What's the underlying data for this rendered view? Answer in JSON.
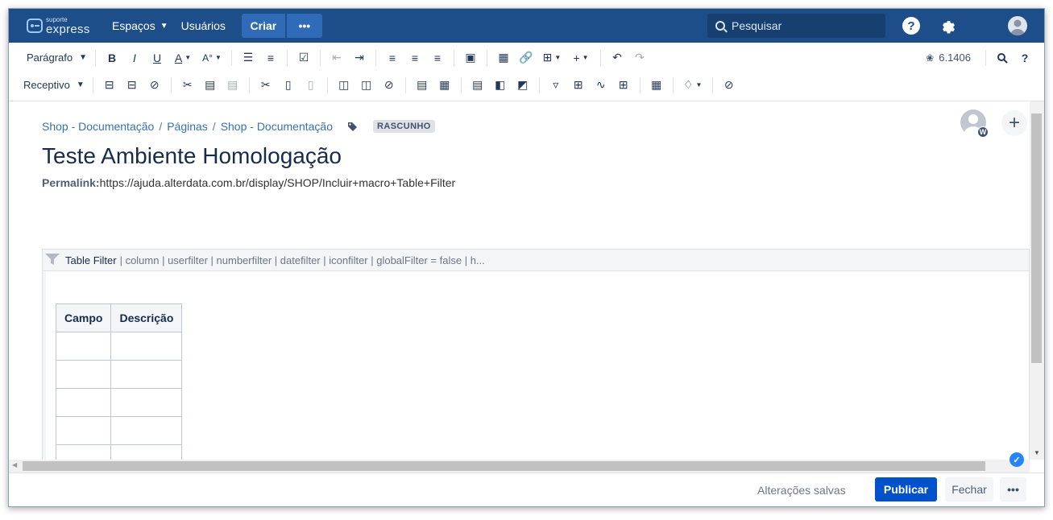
{
  "topnav": {
    "logo_small": "suporte",
    "logo_big": "express",
    "spaces_label": "Espaços",
    "users_label": "Usuários",
    "create_label": "Criar",
    "more_label": "•••",
    "search_placeholder": "Pesquisar",
    "help_label": "?"
  },
  "toolbar": {
    "paragraph_label": "Parágrafo",
    "bold": "B",
    "italic": "I",
    "underline": "U",
    "text_color": "A",
    "more_format": "A°",
    "version_label": "6.1406",
    "search_icon_label": "🔍",
    "help_label": "?",
    "receptivo_label": "Receptivo"
  },
  "page": {
    "breadcrumb": [
      "Shop - Documentação",
      "Páginas",
      "Shop - Documentação"
    ],
    "draft_badge": "RASCUNHO",
    "title": "Teste Ambiente Homologação",
    "permalink_label": "Permalink:",
    "permalink_url": "https://ajuda.alterdata.com.br/display/SHOP/Incluir+macro+Table+Filter",
    "editor_initial": "W"
  },
  "macro": {
    "name": "Table Filter",
    "params": "| column | userfilter | numberfilter | datefilter | iconfilter | globalFilter = false | h..."
  },
  "table": {
    "headers": [
      "Campo",
      "Descrição"
    ],
    "row_count": 5
  },
  "footer": {
    "status": "Alterações salvas",
    "publish_label": "Publicar",
    "close_label": "Fechar",
    "more_label": "•••"
  },
  "colors": {
    "nav_bg": "#1d4e89",
    "primary": "#0052cc",
    "link": "#3572b0"
  }
}
